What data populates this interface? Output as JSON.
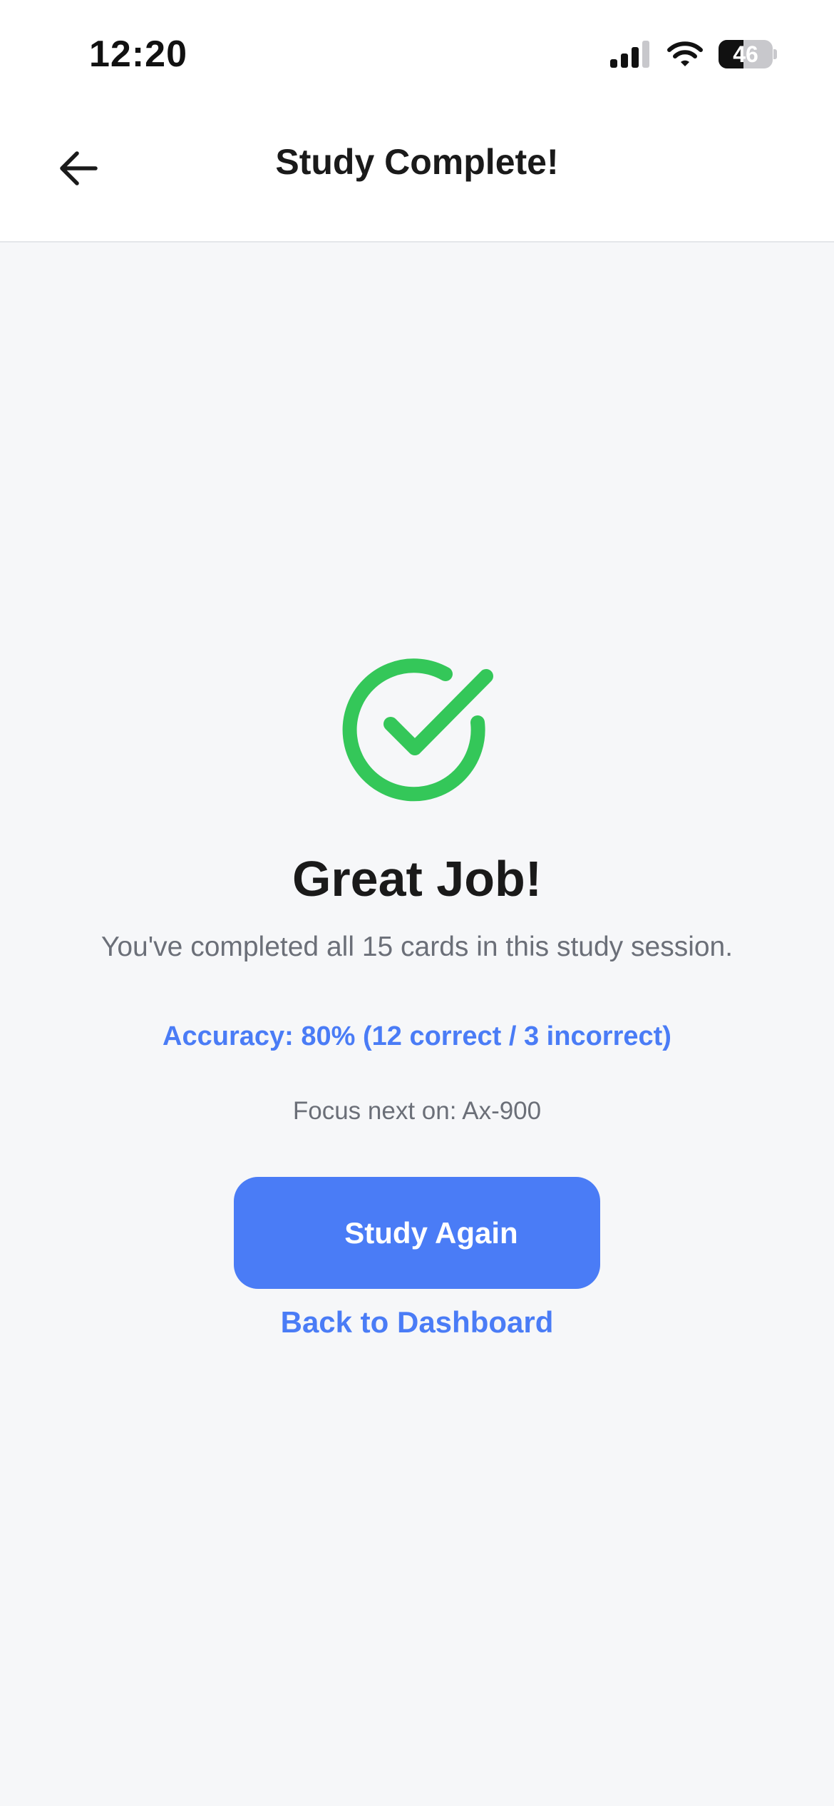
{
  "status_bar": {
    "time": "12:20",
    "battery_level": "46",
    "battery_fraction": 0.46,
    "signal_icon": "cellular-signal-icon",
    "wifi_icon": "wifi-icon",
    "battery_icon": "battery-icon"
  },
  "nav": {
    "title": "Study Complete!",
    "back_icon": "arrow-left-icon"
  },
  "result": {
    "icon": "check-circle-icon",
    "headline": "Great Job!",
    "subtitle": "You've completed all 15 cards in this study session.",
    "accuracy": "Accuracy: 80% (12 correct / 3 incorrect)",
    "focus_next": "Focus next on: Ax-900"
  },
  "actions": {
    "study_again_label": "Study Again",
    "back_to_dashboard_label": "Back to Dashboard"
  },
  "colors": {
    "accent": "#4a7cf6",
    "success": "#34c759",
    "text_primary": "#1a1a1a",
    "text_secondary": "#6b6f78",
    "background": "#f6f7f9"
  }
}
